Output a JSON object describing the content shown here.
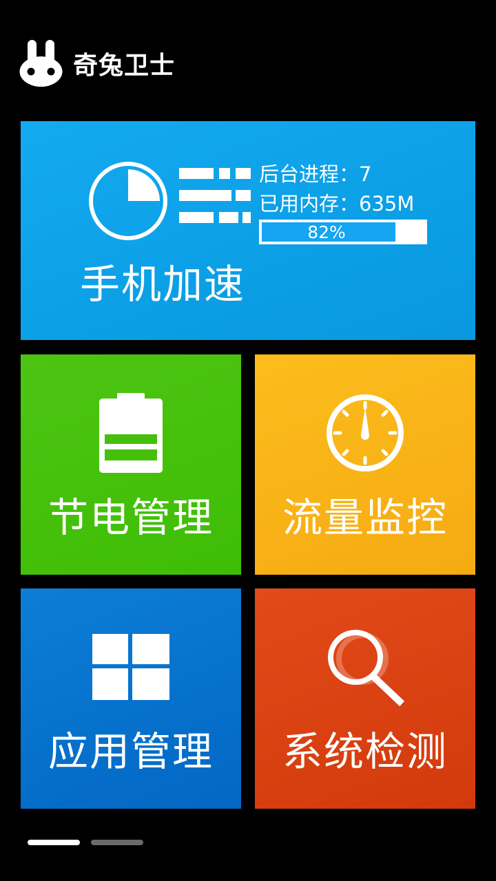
{
  "app": {
    "title": "奇兔卫士"
  },
  "tiles": {
    "speedup": {
      "label": "手机加速",
      "processes_text": "后台进程：7",
      "memory_text": "已用内存：635M",
      "memory_percent_text": "82%",
      "memory_percent": 0.82,
      "color": "#0ba3ea",
      "icon": "pie-chart-icon"
    },
    "power": {
      "label": "节电管理",
      "color": "#44c00a",
      "icon": "battery-icon"
    },
    "traffic": {
      "label": "流量监控",
      "color": "#f9b218",
      "icon": "gauge-icon"
    },
    "apps": {
      "label": "应用管理",
      "color": "#0873cd",
      "icon": "windows-grid-icon"
    },
    "check": {
      "label": "系统检测",
      "color": "#da4213",
      "icon": "magnifier-icon"
    }
  },
  "pager": {
    "pages": 2,
    "current": 1
  }
}
